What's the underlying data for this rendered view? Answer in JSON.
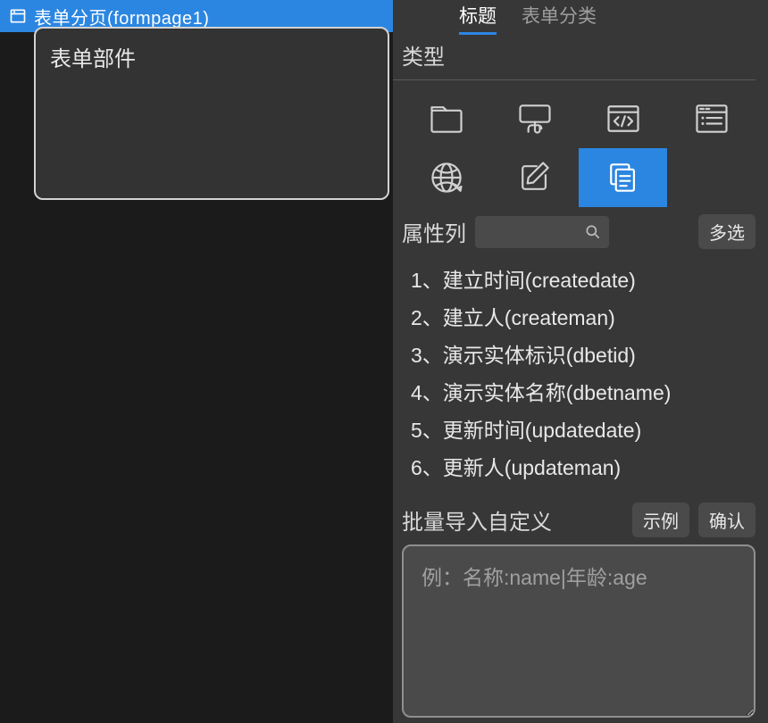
{
  "left": {
    "tree_row_label": "表单分页(formpage1)",
    "form_box_title": "表单部件"
  },
  "right": {
    "tabs": [
      {
        "label": "标题",
        "active": true
      },
      {
        "label": "表单分类",
        "active": false
      }
    ],
    "type_section_title": "类型",
    "type_icons": [
      "folder-icon",
      "pointer-icon",
      "code-icon",
      "form-layout-icon",
      "globe-icon",
      "edit-icon",
      "copy-icon"
    ],
    "selected_type_index": 6,
    "attr_label": "属性列",
    "search_placeholder": "",
    "multi_select_label": "多选",
    "attributes": [
      {
        "idx": "1、",
        "label": "建立时间(createdate)"
      },
      {
        "idx": "2、",
        "label": "建立人(createman)"
      },
      {
        "idx": "3、",
        "label": "演示实体标识(dbetid)"
      },
      {
        "idx": "4、",
        "label": "演示实体名称(dbetname)"
      },
      {
        "idx": "5、",
        "label": "更新时间(updatedate)"
      },
      {
        "idx": "6、",
        "label": "更新人(updateman)"
      }
    ],
    "batch_label": "批量导入自定义",
    "example_btn": "示例",
    "confirm_btn": "确认",
    "batch_placeholder": "例：名称:name|年龄:age"
  }
}
